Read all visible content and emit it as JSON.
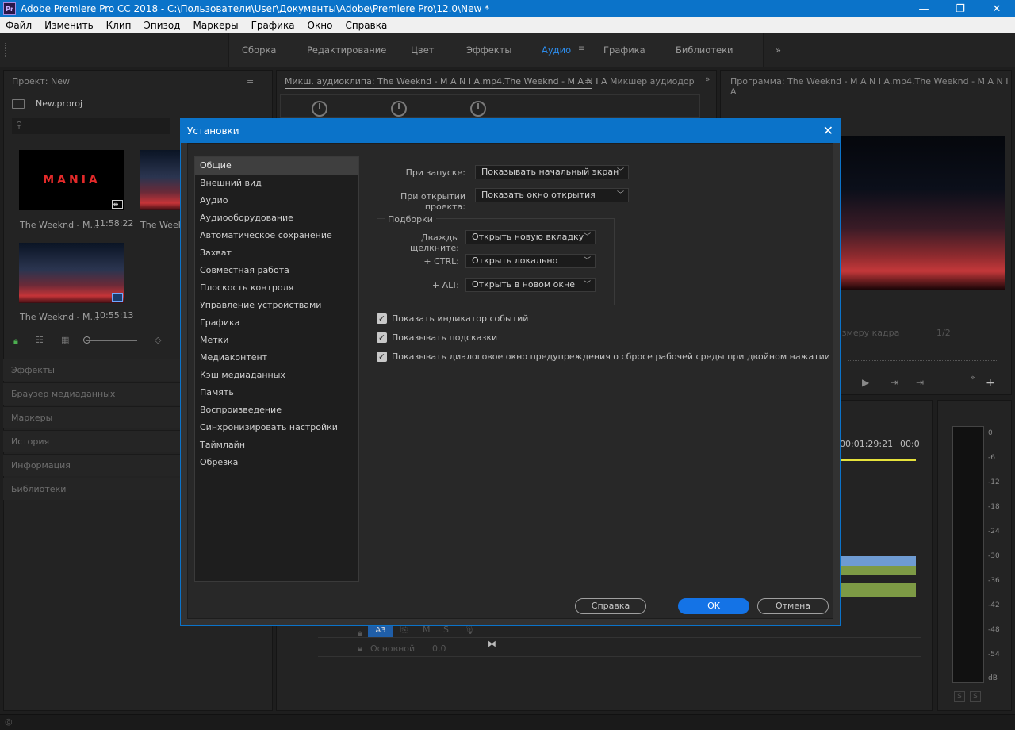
{
  "titlebar": {
    "app_icon": "Pr",
    "title": "Adobe Premiere Pro CC 2018 - C:\\Пользователи\\User\\Документы\\Adobe\\Premiere Pro\\12.0\\New *",
    "minimize": "—",
    "maximize": "❐",
    "close": "✕"
  },
  "menu": [
    "Файл",
    "Изменить",
    "Клип",
    "Эпизод",
    "Маркеры",
    "Графика",
    "Окно",
    "Справка"
  ],
  "workspaces": {
    "tabs": [
      "Сборка",
      "Редактирование",
      "Цвет",
      "Эффекты",
      "Аудио",
      "Графика",
      "Библиотеки"
    ],
    "active": "Аудио",
    "more": "»"
  },
  "project": {
    "header": "Проект: New",
    "file": "New.prproj",
    "thumb_title": "MANIA",
    "clips": [
      {
        "name": "The Weeknd - M...",
        "duration": "11:58:22"
      },
      {
        "name": "The Weekn"
      },
      {
        "name": "The Weeknd - M...",
        "duration": "10:55:13"
      }
    ]
  },
  "left_panels": [
    "Эффекты",
    "Браузер медиаданных",
    "Маркеры",
    "История",
    "Информация",
    "Библиотеки"
  ],
  "audio_mixer": {
    "tab1": "Микш. аудиоклипа: The Weeknd - M A N I A.mp4.The Weeknd - M A N I A",
    "tab2": "Микшер аудиодор",
    "more": "»"
  },
  "program": {
    "header": "Программа: The Weeknd - M A N I A.mp4.The Weeknd - M A N I A",
    "frame_size": "азмеру кадра",
    "resolution": "1/2",
    "add": "+"
  },
  "timeline": {
    "time1": "00:01:29:21",
    "time2": "00:0",
    "track_a3": "A3",
    "master_label": "Основной",
    "master_value": "0,0"
  },
  "meter": {
    "scale": [
      "0",
      "-6",
      "-12",
      "-18",
      "-24",
      "-30",
      "-36",
      "-42",
      "-48",
      "-54",
      "dB"
    ],
    "solo": "S"
  },
  "dialog": {
    "title": "Установки",
    "close": "✕",
    "categories": [
      "Общие",
      "Внешний вид",
      "Аудио",
      "Аудиооборудование",
      "Автоматическое сохранение",
      "Захват",
      "Совместная работа",
      "Плоскость контроля",
      "Управление устройствами",
      "Графика",
      "Метки",
      "Медиаконтент",
      "Кэш медиаданных",
      "Память",
      "Воспроизведение",
      "Синхронизировать настройки",
      "Таймлайн",
      "Обрезка"
    ],
    "selected_category": "Общие",
    "startup_label": "При запуске:",
    "startup_value": "Показывать начальный экран",
    "open_project_label": "При открытии проекта:",
    "open_project_value": "Показать окно открытия",
    "bins_title": "Подборки",
    "double_click_label": "Дважды щелкните:",
    "double_click_value": "Открыть новую вкладку",
    "ctrl_label": "+ CTRL:",
    "ctrl_value": "Открыть локально",
    "alt_label": "+ ALT:",
    "alt_value": "Открыть в новом окне",
    "checkboxes": [
      {
        "label": "Показать индикатор событий",
        "checked": true
      },
      {
        "label": "Показывать подсказки",
        "checked": true
      },
      {
        "label": "Показывать диалоговое окно предупреждения о сбросе рабочей среды при двойном нажатии",
        "checked": true
      }
    ],
    "help_button": "Справка",
    "ok_button": "OK",
    "cancel_button": "Отмена"
  }
}
